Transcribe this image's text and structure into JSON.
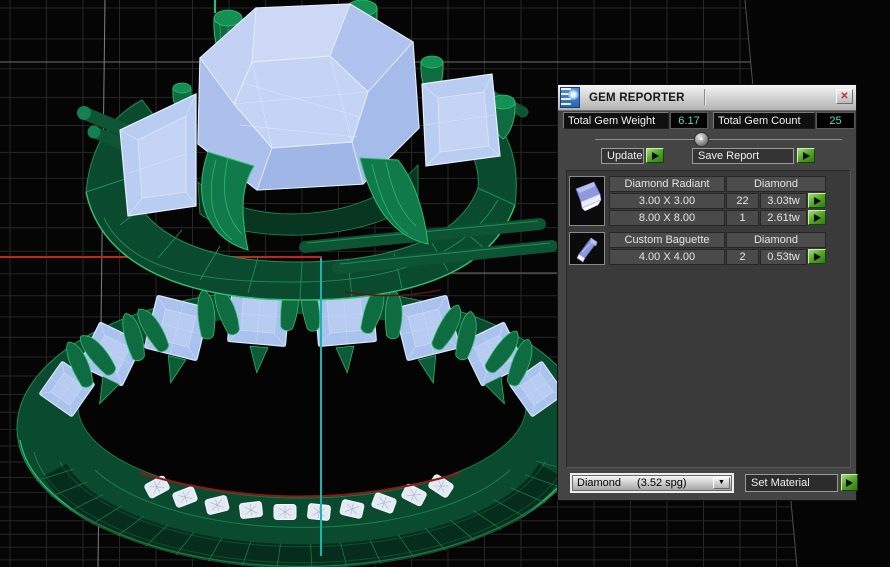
{
  "window": {
    "title": "GEM REPORTER"
  },
  "icons": {
    "close": "✕",
    "collapse": "▲",
    "dropdown": "▼",
    "play": "▶"
  },
  "totals": {
    "weight_label": "Total Gem Weight",
    "weight_value": "6.17",
    "count_label": "Total Gem Count",
    "count_value": "25"
  },
  "actions": {
    "update": "Update",
    "save_report": "Save Report",
    "set_material": "Set Material"
  },
  "gem_groups": [
    {
      "icon": "radiant-gem-icon",
      "cut": "Diamond Radiant",
      "material": "Diamond",
      "rows": [
        {
          "size": "3.00 X 3.00",
          "count": "22",
          "weight": "3.03tw"
        },
        {
          "size": "8.00 X 8.00",
          "count": "1",
          "weight": "2.61tw"
        }
      ]
    },
    {
      "icon": "baguette-gem-icon",
      "cut": "Custom Baguette",
      "material": "Diamond",
      "rows": [
        {
          "size": "4.00 X 4.00",
          "count": "2",
          "weight": "0.53tw"
        }
      ]
    }
  ],
  "material_select": {
    "name": "Diamond",
    "density": "(3.52 spg)"
  },
  "colors": {
    "panel_bg": "#444444",
    "value_text": "#4fe0c0",
    "button_green": "#57ab27",
    "ring_fill": "#0b4d30",
    "ring_wireframe": "#2fbf71",
    "gem_fill": "#aac4ee",
    "axis_x": "#c2251a",
    "axis_vertical": "#1fb3ad",
    "grid_line": "#272727"
  }
}
